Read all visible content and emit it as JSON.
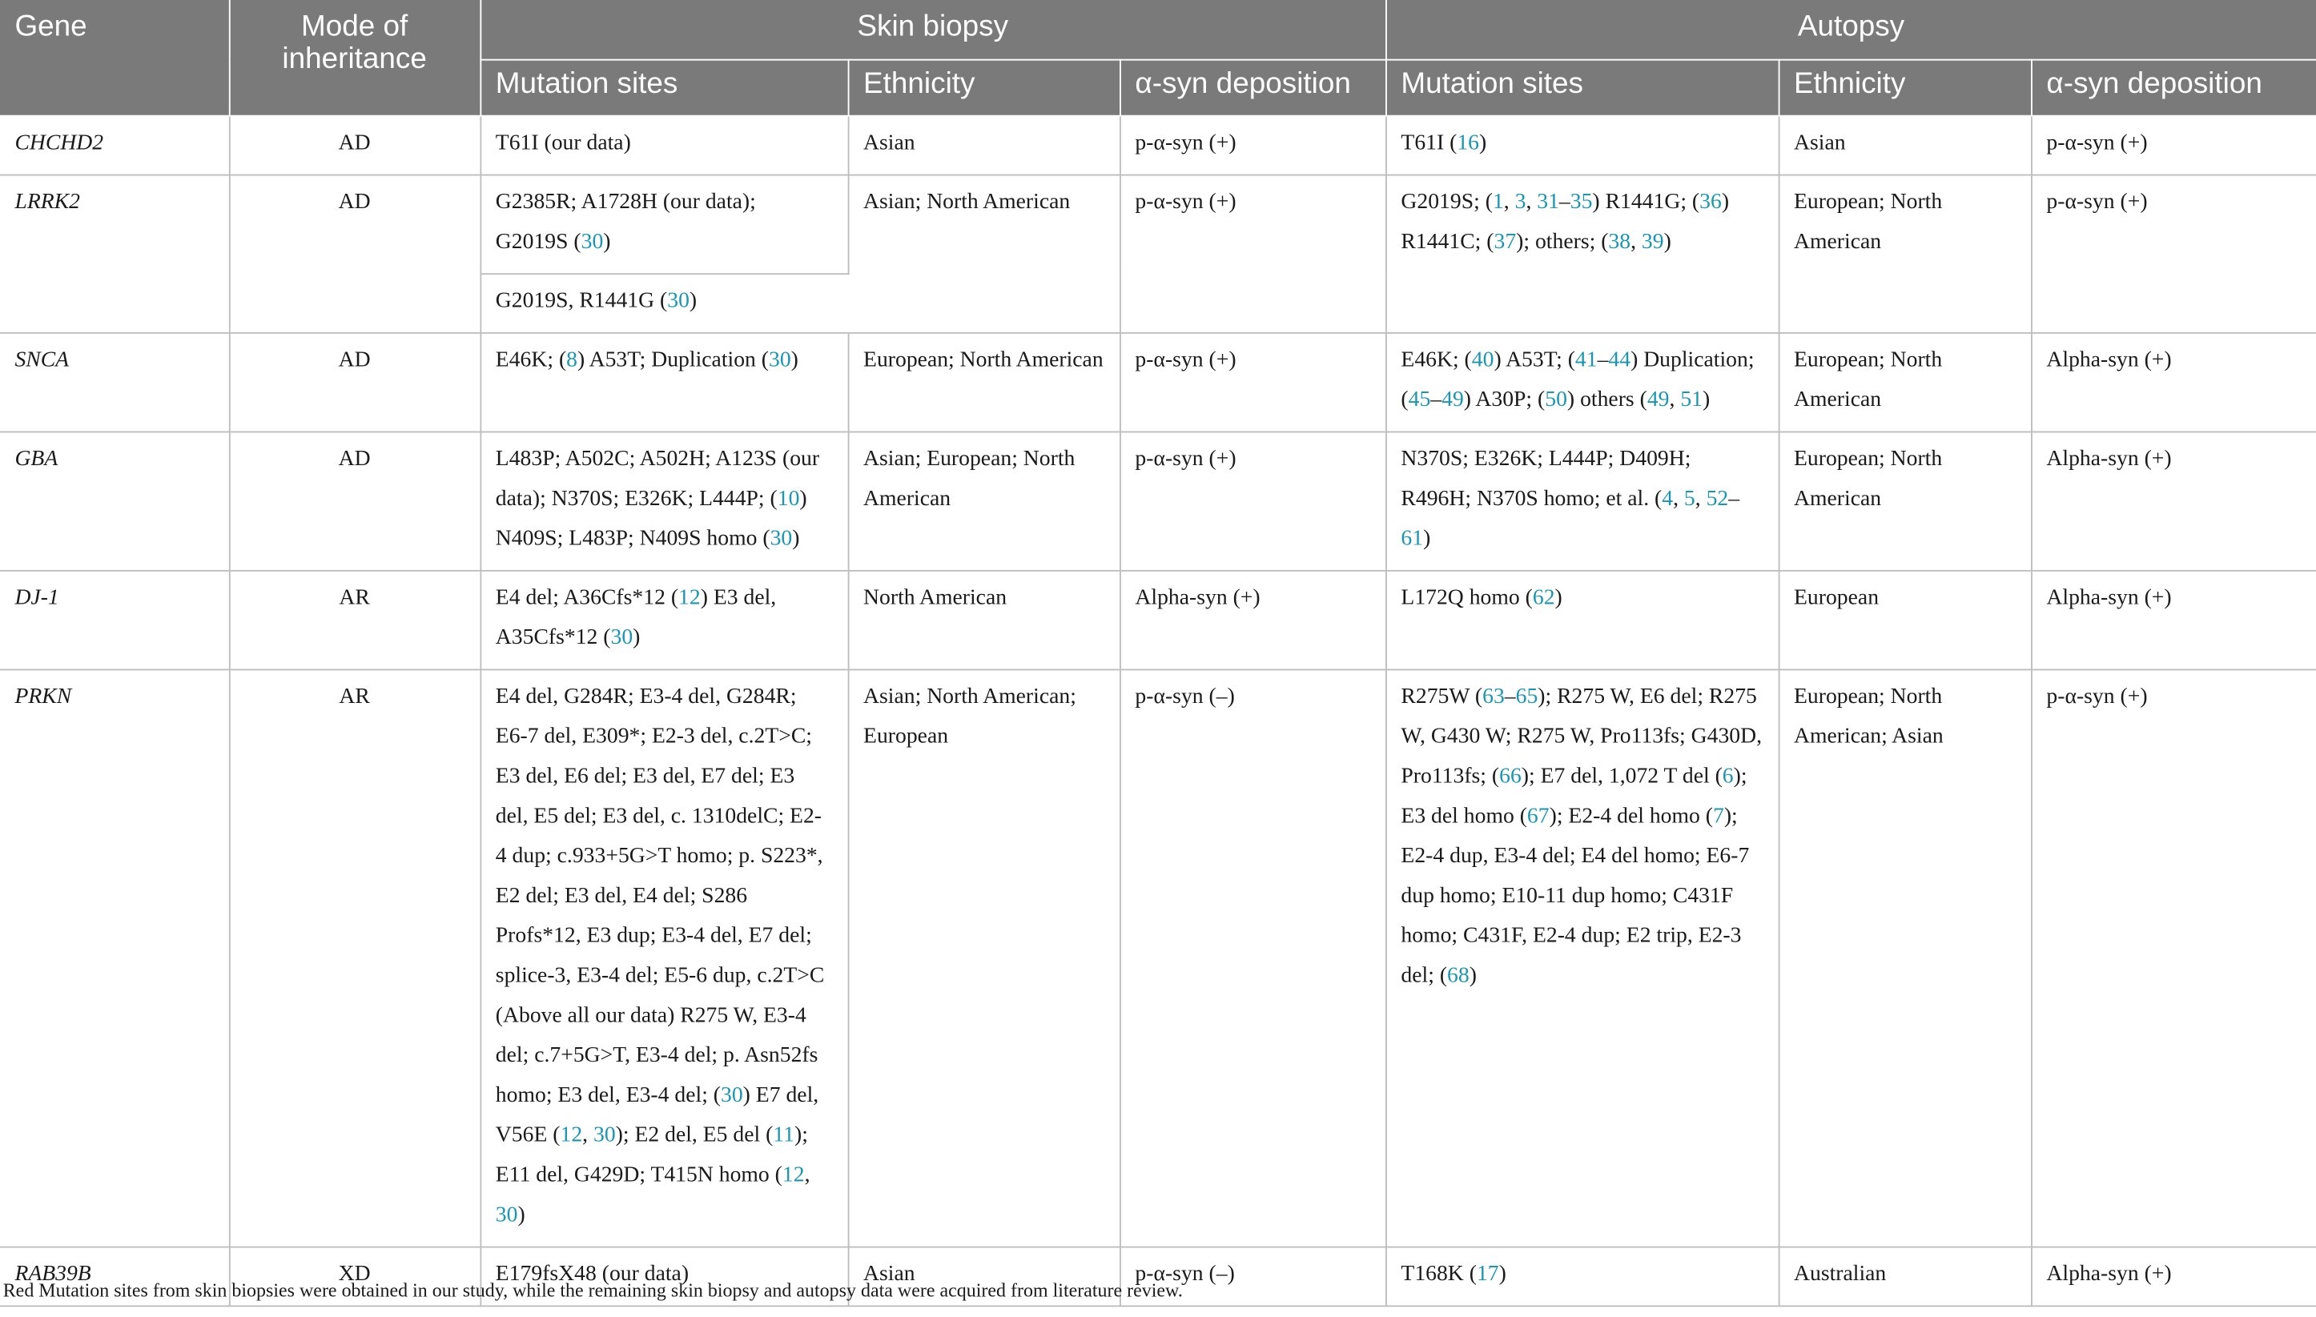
{
  "headers": {
    "gene": "Gene",
    "moi": "Mode of inheritance",
    "skin_biopsy": "Skin biopsy",
    "autopsy": "Autopsy",
    "mutation_sites": "Mutation sites",
    "ethnicity": "Ethnicity",
    "deposition": "α-syn deposition"
  },
  "rows": [
    {
      "gene": "CHCHD2",
      "moi": "AD",
      "skin_mut": [
        {
          "t": "T61I (our data)"
        }
      ],
      "skin_eth": "Asian",
      "skin_dep": "p-α-syn (+)",
      "aut_mut": [
        {
          "t": "T61I ("
        },
        {
          "r": "16"
        },
        {
          "t": ")"
        }
      ],
      "aut_eth": "Asian",
      "aut_dep": "p-α-syn (+)"
    },
    {
      "gene": "LRRK2",
      "moi": "AD",
      "skin_mut": [
        {
          "t": "G2385R; A1728H (our data); G2019S ("
        },
        {
          "r": "30"
        },
        {
          "t": ")"
        }
      ],
      "skin_mut2": [
        {
          "t": "G2019S, R1441G ("
        },
        {
          "r": "30"
        },
        {
          "t": ")"
        }
      ],
      "skin_eth": "Asian; North American",
      "skin_dep": "p-α-syn (+)",
      "aut_mut": [
        {
          "t": "G2019S; ("
        },
        {
          "r": "1"
        },
        {
          "t": ", "
        },
        {
          "r": "3"
        },
        {
          "t": ", "
        },
        {
          "r": "31"
        },
        {
          "t": "–"
        },
        {
          "r": "35"
        },
        {
          "t": ") R1441G; ("
        },
        {
          "r": "36"
        },
        {
          "t": ") R1441C; ("
        },
        {
          "r": "37"
        },
        {
          "t": "); others; ("
        },
        {
          "r": "38"
        },
        {
          "t": ", "
        },
        {
          "r": "39"
        },
        {
          "t": ")"
        }
      ],
      "aut_eth": "European; North American",
      "aut_dep": "p-α-syn (+)"
    },
    {
      "gene": "SNCA",
      "moi": "AD",
      "skin_mut": [
        {
          "t": "E46K; ("
        },
        {
          "r": "8"
        },
        {
          "t": ") A53T; Duplication ("
        },
        {
          "r": "30"
        },
        {
          "t": ")"
        }
      ],
      "skin_eth": "European; North American",
      "skin_dep": "p-α-syn (+)",
      "aut_mut": [
        {
          "t": "E46K; ("
        },
        {
          "r": "40"
        },
        {
          "t": ") A53T; ("
        },
        {
          "r": "41"
        },
        {
          "t": "–"
        },
        {
          "r": "44"
        },
        {
          "t": ") Duplication; ("
        },
        {
          "r": "45"
        },
        {
          "t": "–"
        },
        {
          "r": "49"
        },
        {
          "t": ") A30P; ("
        },
        {
          "r": "50"
        },
        {
          "t": ") others ("
        },
        {
          "r": "49"
        },
        {
          "t": ", "
        },
        {
          "r": "51"
        },
        {
          "t": ")"
        }
      ],
      "aut_eth": "European; North American",
      "aut_dep": "Alpha-syn (+)"
    },
    {
      "gene": "GBA",
      "moi": "AD",
      "skin_mut": [
        {
          "t": "L483P; A502C; A502H; A123S (our data); N370S; E326K; L444P; ("
        },
        {
          "r": "10"
        },
        {
          "t": ") N409S; L483P; N409S homo ("
        },
        {
          "r": "30"
        },
        {
          "t": ")"
        }
      ],
      "skin_eth": "Asian; European; North American",
      "skin_dep": "p-α-syn (+)",
      "aut_mut": [
        {
          "t": "N370S; E326K; L444P; D409H; R496H; N370S homo; et al. ("
        },
        {
          "r": "4"
        },
        {
          "t": ", "
        },
        {
          "r": "5"
        },
        {
          "t": ", "
        },
        {
          "r": "52"
        },
        {
          "t": "–"
        },
        {
          "r": "61"
        },
        {
          "t": ")"
        }
      ],
      "aut_eth": "European; North American",
      "aut_dep": "Alpha-syn (+)"
    },
    {
      "gene": "DJ-1",
      "moi": "AR",
      "skin_mut": [
        {
          "t": "E4 del; A36Cfs*12 ("
        },
        {
          "r": "12"
        },
        {
          "t": ") E3 del, A35Cfs*12 ("
        },
        {
          "r": "30"
        },
        {
          "t": ")"
        }
      ],
      "skin_eth": "North American",
      "skin_dep": "Alpha-syn (+)",
      "aut_mut": [
        {
          "t": "L172Q homo ("
        },
        {
          "r": "62"
        },
        {
          "t": ")"
        }
      ],
      "aut_eth": "European",
      "aut_dep": "Alpha-syn (+)"
    },
    {
      "gene": "PRKN",
      "moi": "AR",
      "skin_mut": [
        {
          "t": "E4 del, G284R; E3-4 del, G284R; E6-7 del, E309*; E2-3 del, c.2T>C; E3 del, E6 del; E3 del, E7 del; E3 del, E5 del; E3 del, c. 1310delC; E2-4 dup; c.933+5G>T homo; p. S223*, E2 del; E3 del, E4 del; S286 Profs*12, E3 dup; E3-4 del, E7 del; splice-3, E3-4 del; E5-6 dup, c.2T>C (Above all our data) R275 W, E3-4 del; c.7+5G>T, E3-4 del; p. Asn52fs homo; E3 del, E3-4 del; ("
        },
        {
          "r": "30"
        },
        {
          "t": ") E7 del, V56E ("
        },
        {
          "r": "12"
        },
        {
          "t": ", "
        },
        {
          "r": "30"
        },
        {
          "t": "); E2 del, E5 del ("
        },
        {
          "r": "11"
        },
        {
          "t": "); E11 del, G429D; T415N homo ("
        },
        {
          "r": "12"
        },
        {
          "t": ", "
        },
        {
          "r": "30"
        },
        {
          "t": ")"
        }
      ],
      "skin_eth": "Asian; North American; European",
      "skin_dep": "p-α-syn (–)",
      "aut_mut": [
        {
          "t": "R275W ("
        },
        {
          "r": "63"
        },
        {
          "t": "–"
        },
        {
          "r": "65"
        },
        {
          "t": "); R275 W, E6 del; R275 W, G430 W; R275 W, Pro113fs; G430D, Pro113fs; ("
        },
        {
          "r": "66"
        },
        {
          "t": "); E7 del, 1,072 T del ("
        },
        {
          "r": "6"
        },
        {
          "t": "); E3 del homo ("
        },
        {
          "r": "67"
        },
        {
          "t": "); E2-4 del homo ("
        },
        {
          "r": "7"
        },
        {
          "t": "); E2-4 dup, E3-4 del; E4 del homo; E6-7 dup homo; E10-11 dup homo; C431F homo; C431F, E2-4 dup; E2 trip, E2-3 del; ("
        },
        {
          "r": "68"
        },
        {
          "t": ")"
        }
      ],
      "aut_eth": "European; North American; Asian",
      "aut_dep": "p-α-syn (+)"
    },
    {
      "gene": "RAB39B",
      "moi": "XD",
      "skin_mut": [
        {
          "t": "E179fsX48 (our data)"
        }
      ],
      "skin_eth": "Asian",
      "skin_dep": "p-α-syn (–)",
      "aut_mut": [
        {
          "t": "T168K ("
        },
        {
          "r": "17"
        },
        {
          "t": ")"
        }
      ],
      "aut_eth": "Australian",
      "aut_dep": "Alpha-syn (+)"
    }
  ],
  "footnote": "Red Mutation sites from skin biopsies were obtained in our study, while the remaining skin biopsy and autopsy data were acquired from literature review."
}
